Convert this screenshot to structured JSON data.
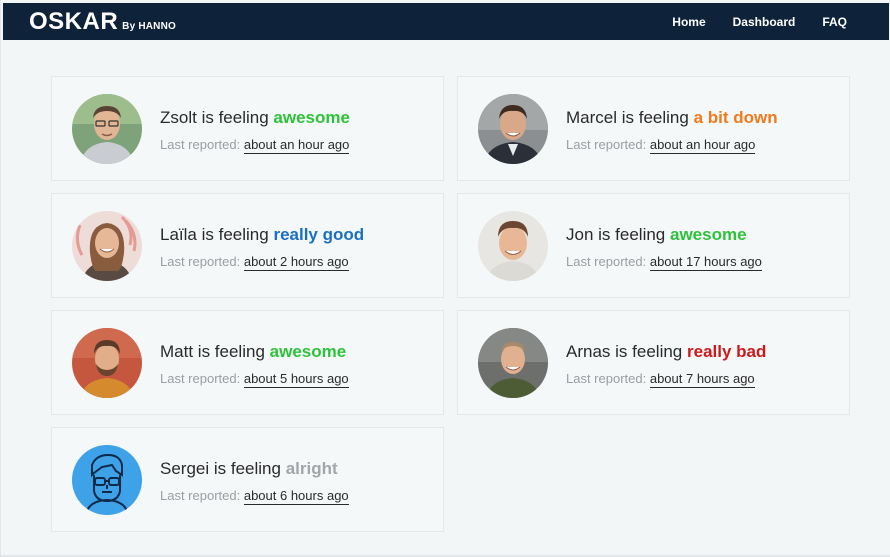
{
  "nav": {
    "logo": "OSKAR",
    "logo_sub": "By HANNO",
    "links": [
      "Home",
      "Dashboard",
      "FAQ"
    ]
  },
  "labels": {
    "is_feeling": "is feeling",
    "last_reported": "Last reported:"
  },
  "colors": {
    "awesome": "#2ec23a",
    "a bit down": "#f07a1c",
    "really good": "#1a6fc6",
    "really bad": "#cc1a1a",
    "alright": "#a3a6a8"
  },
  "users": [
    {
      "name": "Zsolt",
      "mood": "awesome",
      "time": "about an hour ago",
      "avatar": "photo"
    },
    {
      "name": "Marcel",
      "mood": "a bit down",
      "time": "about an hour ago",
      "avatar": "photo"
    },
    {
      "name": "Laïla",
      "mood": "really good",
      "time": "about 2 hours ago",
      "avatar": "photo"
    },
    {
      "name": "Jon",
      "mood": "awesome",
      "time": "about 17 hours ago",
      "avatar": "photo"
    },
    {
      "name": "Matt",
      "mood": "awesome",
      "time": "about 5 hours ago",
      "avatar": "photo"
    },
    {
      "name": "Arnas",
      "mood": "really bad",
      "time": "about 7 hours ago",
      "avatar": "photo"
    },
    {
      "name": "Sergei",
      "mood": "alright",
      "time": "about 6 hours ago",
      "avatar": "cartoon-face-icon"
    }
  ]
}
